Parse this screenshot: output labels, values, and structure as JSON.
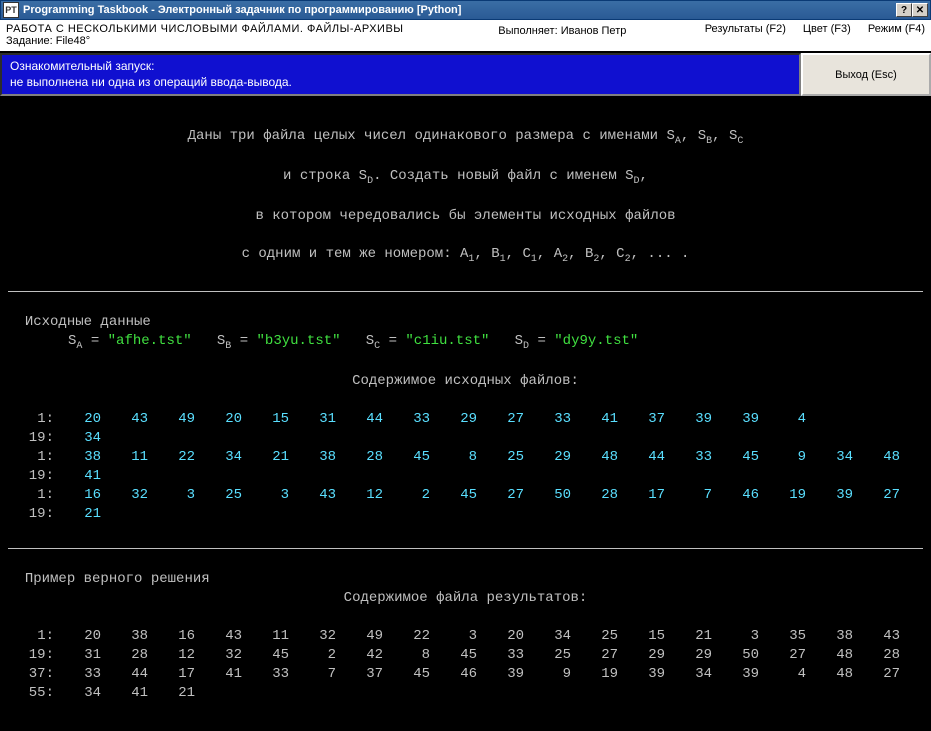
{
  "titlebar": {
    "icon": "PT",
    "text": "Programming Taskbook - Электронный задачник по программированию [Python]",
    "help": "?",
    "close": "✕"
  },
  "infobar": {
    "heading": "РАБОТА С НЕСКОЛЬКИМИ ЧИСЛОВЫМИ ФАЙЛАМИ. ФАЙЛЫ-АРХИВЫ",
    "task_label": "Задание: File48°",
    "author_label": "Выполняет: Иванов Петр",
    "hk_results": "Результаты (F2)",
    "hk_color": "Цвет (F3)",
    "hk_mode": "Режим (F4)"
  },
  "status": {
    "line1": "Ознакомительный запуск:",
    "line2": "  не выполнена ни одна из операций ввода-вывода.",
    "exit": "Выход (Esc)"
  },
  "desc": {
    "l1_a": "Даны три файла целых чисел одинакового размера с именами S",
    "l1_b": ", S",
    "l1_c": ", S",
    "l2_a": "и строка S",
    "l2_b": ". Создать новый файл с именем S",
    "l2_c": ",",
    "l3": "в котором чередовались бы элементы исходных файлов",
    "l4_a": "с одним и тем же номером: A",
    "l4_b": ", B",
    "l4_c": ", C",
    "l4_d": ", A",
    "l4_e": ", B",
    "l4_f": ", C",
    "l4_g": ", ... .",
    "subA": "A",
    "subB": "B",
    "subC": "C",
    "subD": "D",
    "sub1": "1",
    "sub2": "2"
  },
  "section_input": "Исходные данные",
  "vars": {
    "sa_lbl": "S",
    "sa_sub": "A",
    "sa_val": "\"afhe.tst\"",
    "sb_lbl": "S",
    "sb_sub": "B",
    "sb_val": "\"b3yu.tst\"",
    "sc_lbl": "S",
    "sc_sub": "C",
    "sc_val": "\"c1iu.tst\"",
    "sd_lbl": "S",
    "sd_sub": "D",
    "sd_val": "\"dy9y.tst\"",
    "eq": " = "
  },
  "content_label_in": "Содержимое исходных файлов:",
  "input_rows": [
    {
      "idx": "1:",
      "v": [
        20,
        43,
        49,
        20,
        15,
        31,
        44,
        33,
        29,
        27,
        33,
        41,
        37,
        39,
        39,
        4
      ]
    },
    {
      "idx": "19:",
      "v": [
        34
      ]
    },
    {
      "idx": "1:",
      "v": [
        38,
        11,
        22,
        34,
        21,
        38,
        28,
        45,
        8,
        25,
        29,
        48,
        44,
        33,
        45,
        9,
        34,
        48
      ]
    },
    {
      "idx": "19:",
      "v": [
        41
      ]
    },
    {
      "idx": "1:",
      "v": [
        16,
        32,
        3,
        25,
        3,
        43,
        12,
        2,
        45,
        27,
        50,
        28,
        17,
        7,
        46,
        19,
        39,
        27
      ]
    },
    {
      "idx": "19:",
      "v": [
        21
      ]
    }
  ],
  "section_output": "Пример верного решения",
  "content_label_out": "Содержимое файла результатов:",
  "output_rows": [
    {
      "idx": "1:",
      "v": [
        20,
        38,
        16,
        43,
        11,
        32,
        49,
        22,
        3,
        20,
        34,
        25,
        15,
        21,
        3,
        35,
        38,
        43
      ]
    },
    {
      "idx": "19:",
      "v": [
        31,
        28,
        12,
        32,
        45,
        2,
        42,
        8,
        45,
        33,
        25,
        27,
        29,
        29,
        50,
        27,
        48,
        28
      ]
    },
    {
      "idx": "37:",
      "v": [
        33,
        44,
        17,
        41,
        33,
        7,
        37,
        45,
        46,
        39,
        9,
        19,
        39,
        34,
        39,
        4,
        48,
        27
      ]
    },
    {
      "idx": "55:",
      "v": [
        34,
        41,
        21
      ]
    }
  ]
}
